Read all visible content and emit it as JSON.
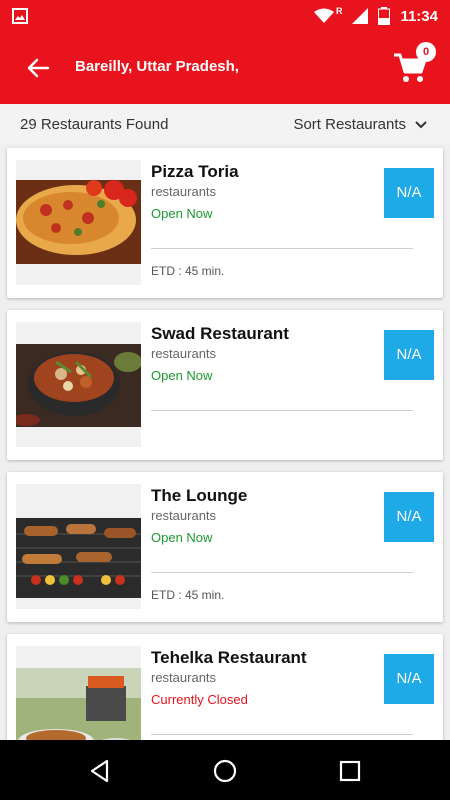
{
  "status_bar": {
    "time": "11:34",
    "signal_label": "R"
  },
  "app_bar": {
    "location": "Bareilly, Uttar Pradesh,",
    "cart_count": "0"
  },
  "sub_header": {
    "count_text": "29 Restaurants Found",
    "sort_label": "Sort Restaurants"
  },
  "restaurants": [
    {
      "name": "Pizza Toria",
      "category": "restaurants",
      "status": "Open Now",
      "etd": "ETD : 45 min.",
      "rating": "N/A"
    },
    {
      "name": "Swad Restaurant",
      "category": "restaurants",
      "status": "Open Now",
      "etd": "",
      "rating": "N/A"
    },
    {
      "name": "The Lounge",
      "category": "restaurants",
      "status": "Open Now",
      "etd": "ETD : 45 min.",
      "rating": "N/A"
    },
    {
      "name": "Tehelka Restaurant",
      "category": "restaurants",
      "status": "Currently Closed",
      "etd": "",
      "rating": "N/A"
    }
  ],
  "colors": {
    "brand": "#e8131d",
    "open": "#1a9a2d",
    "closed": "#e8131d",
    "rating_bg": "#1eaae7"
  }
}
